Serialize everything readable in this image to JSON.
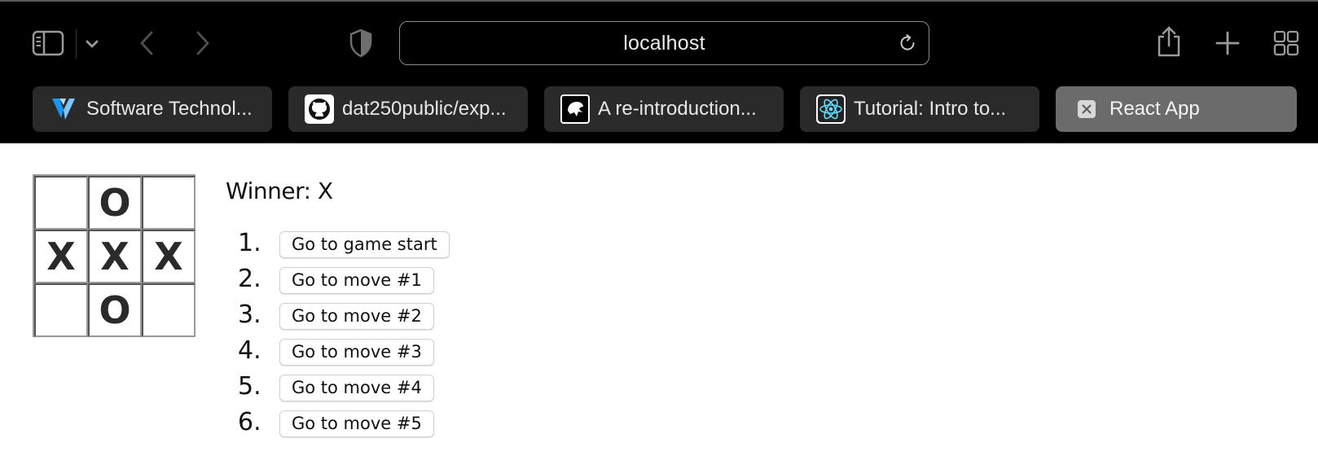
{
  "browser": {
    "address": "localhost",
    "tabs": [
      {
        "label": "Software Technol...",
        "icon": "vuetify-icon",
        "active": false
      },
      {
        "label": "dat250public/exp...",
        "icon": "github-icon",
        "active": false
      },
      {
        "label": "A re-introduction...",
        "icon": "mdn-icon",
        "active": false
      },
      {
        "label": "Tutorial: Intro to...",
        "icon": "react-icon",
        "active": false
      },
      {
        "label": "React App",
        "icon": "close-icon",
        "active": true
      }
    ]
  },
  "game": {
    "status": "Winner: X",
    "board": [
      "",
      "O",
      "",
      "X",
      "X",
      "X",
      "",
      "O",
      ""
    ],
    "moves": [
      {
        "number": "1.",
        "label": "Go to game start"
      },
      {
        "number": "2.",
        "label": "Go to move #1"
      },
      {
        "number": "3.",
        "label": "Go to move #2"
      },
      {
        "number": "4.",
        "label": "Go to move #3"
      },
      {
        "number": "5.",
        "label": "Go to move #4"
      },
      {
        "number": "6.",
        "label": "Go to move #5"
      }
    ]
  },
  "colors": {
    "chrome_bg": "#000000",
    "tab_bg": "#2a2a2a",
    "tab_active_bg": "#6b6b6b",
    "board_border": "#999999"
  }
}
